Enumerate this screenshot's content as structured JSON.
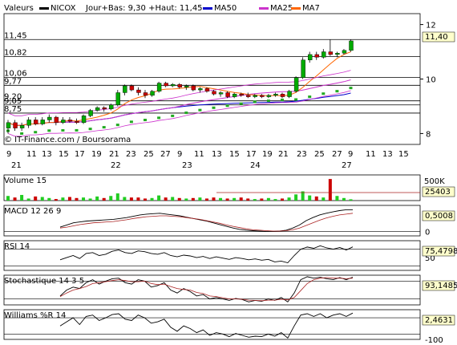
{
  "colors": {
    "price_up": "#00aa00",
    "price_down": "#cc0000",
    "ma50": "#0000cc",
    "ma25": "#cc33cc",
    "ma7": "#ff6600",
    "ma_dots_main": "#22aa22",
    "ma_dots_resist": "#aa2222",
    "grid": "#000000",
    "value_box": "#ffffcc",
    "volume_up": "#22cc22",
    "volume_down": "#cc0000",
    "indicator_line": "#000000",
    "signal_line": "#aa2222"
  },
  "legend": {
    "title": "Valeurs",
    "symbol": "NICOX",
    "day_range": "Jour+Bas: 9,30 +Haut: 11,45",
    "ma50": "MA50",
    "ma25": "MA25",
    "ma7": "MA7"
  },
  "watermark": "© IT-Finance.com / Boursorama",
  "chart_data": [
    {
      "type": "candlestick",
      "title": "NICOX",
      "ylim": [
        7.6,
        12.4
      ],
      "y_ticks": [
        "12",
        "10",
        "8"
      ],
      "price_levels": [
        {
          "label": "11,45",
          "value": 11.45
        },
        {
          "label": "10,82",
          "value": 10.82
        },
        {
          "label": "10,06",
          "value": 10.06
        },
        {
          "label": "9,77",
          "value": 9.77
        },
        {
          "label": "9,20",
          "value": 9.2
        },
        {
          "label": "9,05",
          "value": 9.05
        },
        {
          "label": "8,75",
          "value": 8.75
        }
      ],
      "last_value": "11,40",
      "x_tick_labels": [
        "9",
        "11",
        "13",
        "15",
        "17",
        "19",
        "21",
        "23",
        "25",
        "27"
      ],
      "month_labels": [
        "21",
        "22",
        "23",
        "24",
        "27"
      ],
      "candles": [
        {
          "o": 8.2,
          "h": 8.5,
          "l": 8.0,
          "c": 8.4
        },
        {
          "o": 8.4,
          "h": 8.5,
          "l": 8.1,
          "c": 8.2
        },
        {
          "o": 8.2,
          "h": 8.4,
          "l": 8.1,
          "c": 8.3
        },
        {
          "o": 8.3,
          "h": 8.6,
          "l": 8.2,
          "c": 8.5
        },
        {
          "o": 8.5,
          "h": 8.6,
          "l": 8.3,
          "c": 8.35
        },
        {
          "o": 8.35,
          "h": 8.6,
          "l": 8.3,
          "c": 8.5
        },
        {
          "o": 8.5,
          "h": 8.7,
          "l": 8.4,
          "c": 8.6
        },
        {
          "o": 8.6,
          "h": 8.65,
          "l": 8.3,
          "c": 8.4
        },
        {
          "o": 8.4,
          "h": 8.6,
          "l": 8.35,
          "c": 8.5
        },
        {
          "o": 8.5,
          "h": 8.6,
          "l": 8.4,
          "c": 8.45
        },
        {
          "o": 8.45,
          "h": 8.55,
          "l": 8.35,
          "c": 8.4
        },
        {
          "o": 8.4,
          "h": 8.7,
          "l": 8.35,
          "c": 8.65
        },
        {
          "o": 8.65,
          "h": 8.9,
          "l": 8.6,
          "c": 8.85
        },
        {
          "o": 8.85,
          "h": 9.0,
          "l": 8.8,
          "c": 8.95
        },
        {
          "o": 8.95,
          "h": 9.0,
          "l": 8.8,
          "c": 8.9
        },
        {
          "o": 8.9,
          "h": 9.1,
          "l": 8.85,
          "c": 9.05
        },
        {
          "o": 9.05,
          "h": 9.6,
          "l": 9.0,
          "c": 9.5
        },
        {
          "o": 9.5,
          "h": 9.8,
          "l": 9.4,
          "c": 9.75
        },
        {
          "o": 9.75,
          "h": 9.8,
          "l": 9.55,
          "c": 9.6
        },
        {
          "o": 9.6,
          "h": 9.7,
          "l": 9.4,
          "c": 9.5
        },
        {
          "o": 9.5,
          "h": 9.6,
          "l": 9.3,
          "c": 9.4
        },
        {
          "o": 9.4,
          "h": 9.6,
          "l": 9.35,
          "c": 9.55
        },
        {
          "o": 9.55,
          "h": 9.9,
          "l": 9.5,
          "c": 9.85
        },
        {
          "o": 9.85,
          "h": 9.9,
          "l": 9.7,
          "c": 9.75
        },
        {
          "o": 9.75,
          "h": 9.85,
          "l": 9.7,
          "c": 9.8
        },
        {
          "o": 9.8,
          "h": 9.85,
          "l": 9.65,
          "c": 9.7
        },
        {
          "o": 9.7,
          "h": 9.8,
          "l": 9.6,
          "c": 9.75
        },
        {
          "o": 9.75,
          "h": 9.8,
          "l": 9.55,
          "c": 9.6
        },
        {
          "o": 9.6,
          "h": 9.7,
          "l": 9.5,
          "c": 9.65
        },
        {
          "o": 9.65,
          "h": 9.7,
          "l": 9.5,
          "c": 9.55
        },
        {
          "o": 9.55,
          "h": 9.6,
          "l": 9.4,
          "c": 9.45
        },
        {
          "o": 9.45,
          "h": 9.55,
          "l": 9.35,
          "c": 9.5
        },
        {
          "o": 9.5,
          "h": 9.55,
          "l": 9.3,
          "c": 9.35
        },
        {
          "o": 9.35,
          "h": 9.5,
          "l": 9.3,
          "c": 9.45
        },
        {
          "o": 9.45,
          "h": 9.5,
          "l": 9.35,
          "c": 9.4
        },
        {
          "o": 9.4,
          "h": 9.5,
          "l": 9.3,
          "c": 9.35
        },
        {
          "o": 9.35,
          "h": 9.45,
          "l": 9.3,
          "c": 9.4
        },
        {
          "o": 9.4,
          "h": 9.45,
          "l": 9.3,
          "c": 9.35
        },
        {
          "o": 9.35,
          "h": 9.45,
          "l": 9.3,
          "c": 9.4
        },
        {
          "o": 9.4,
          "h": 9.5,
          "l": 9.35,
          "c": 9.45
        },
        {
          "o": 9.45,
          "h": 9.5,
          "l": 9.3,
          "c": 9.35
        },
        {
          "o": 9.35,
          "h": 9.6,
          "l": 9.3,
          "c": 9.55
        },
        {
          "o": 9.55,
          "h": 10.1,
          "l": 9.5,
          "c": 10.05
        },
        {
          "o": 10.05,
          "h": 10.8,
          "l": 10.0,
          "c": 10.7
        },
        {
          "o": 10.7,
          "h": 11.0,
          "l": 10.6,
          "c": 10.9
        },
        {
          "o": 10.9,
          "h": 11.0,
          "l": 10.7,
          "c": 10.8
        },
        {
          "o": 10.8,
          "h": 11.1,
          "l": 10.75,
          "c": 11.0
        },
        {
          "o": 11.0,
          "h": 11.45,
          "l": 10.85,
          "c": 10.9
        },
        {
          "o": 10.9,
          "h": 11.0,
          "l": 10.8,
          "c": 10.95
        },
        {
          "o": 10.95,
          "h": 11.1,
          "l": 10.9,
          "c": 11.05
        },
        {
          "o": 11.05,
          "h": 11.45,
          "l": 11.0,
          "c": 11.4
        }
      ]
    },
    {
      "type": "bar",
      "title": "Volume 15",
      "y_ticks": [
        "500K"
      ],
      "last_value": "25403",
      "ylim": [
        0,
        500000
      ],
      "values": [
        90000,
        60000,
        110000,
        40000,
        80000,
        70000,
        50000,
        30000,
        60000,
        70000,
        50000,
        60000,
        40000,
        80000,
        50000,
        90000,
        140000,
        70000,
        60000,
        60000,
        40000,
        50000,
        100000,
        60000,
        70000,
        50000,
        40000,
        50000,
        60000,
        40000,
        60000,
        50000,
        40000,
        50000,
        60000,
        40000,
        30000,
        40000,
        50000,
        30000,
        40000,
        60000,
        120000,
        180000,
        100000,
        80000,
        60000,
        420000,
        90000,
        50000,
        25403
      ]
    },
    {
      "type": "line",
      "title": "MACD 12 26 9",
      "y_ticks": [
        "0"
      ],
      "last_value": "0,5008",
      "ylim": [
        -0.1,
        0.6
      ],
      "series": [
        {
          "values": [
            0.1,
            0.15,
            0.2,
            0.22,
            0.24,
            0.25,
            0.26,
            0.27,
            0.28,
            0.3,
            0.32,
            0.35,
            0.38,
            0.4,
            0.41,
            0.42,
            0.4,
            0.38,
            0.36,
            0.33,
            0.3,
            0.27,
            0.24,
            0.2,
            0.16,
            0.12,
            0.08,
            0.05,
            0.03,
            0.02,
            0.01,
            0.0,
            0.0,
            0.01,
            0.03,
            0.08,
            0.15,
            0.25,
            0.32,
            0.38,
            0.42,
            0.45,
            0.48,
            0.5,
            0.5008
          ]
        },
        {
          "values": [
            0.08,
            0.1,
            0.13,
            0.16,
            0.18,
            0.2,
            0.21,
            0.22,
            0.23,
            0.25,
            0.27,
            0.3,
            0.32,
            0.34,
            0.35,
            0.36,
            0.36,
            0.35,
            0.34,
            0.32,
            0.3,
            0.28,
            0.25,
            0.22,
            0.19,
            0.15,
            0.12,
            0.09,
            0.06,
            0.04,
            0.03,
            0.02,
            0.01,
            0.01,
            0.02,
            0.04,
            0.08,
            0.14,
            0.2,
            0.26,
            0.31,
            0.35,
            0.38,
            0.4,
            0.42
          ]
        }
      ]
    },
    {
      "type": "line",
      "title": "RSI 14",
      "y_ticks": [
        "50"
      ],
      "last_value": "75,4798",
      "ylim": [
        20,
        90
      ],
      "series": [
        {
          "values": [
            45,
            50,
            55,
            48,
            60,
            62,
            55,
            58,
            65,
            68,
            62,
            60,
            66,
            64,
            60,
            58,
            62,
            55,
            52,
            56,
            54,
            50,
            53,
            48,
            52,
            49,
            46,
            50,
            48,
            45,
            47,
            44,
            46,
            40,
            42,
            38,
            55,
            70,
            75,
            72,
            78,
            73,
            70,
            74,
            68,
            75.48
          ]
        }
      ]
    },
    {
      "type": "line",
      "title": "Stochastique 14 3 5",
      "last_value": "93,1485",
      "ylim": [
        0,
        100
      ],
      "series": [
        {
          "values": [
            30,
            50,
            60,
            55,
            75,
            85,
            70,
            80,
            88,
            90,
            75,
            70,
            85,
            80,
            60,
            65,
            75,
            50,
            40,
            55,
            45,
            30,
            35,
            20,
            25,
            20,
            15,
            22,
            18,
            10,
            15,
            12,
            20,
            15,
            25,
            10,
            40,
            85,
            95,
            90,
            93,
            88,
            85,
            92,
            85,
            93.1485
          ]
        },
        {
          "values": [
            28,
            40,
            50,
            55,
            62,
            72,
            75,
            78,
            82,
            85,
            82,
            78,
            78,
            80,
            72,
            68,
            70,
            62,
            55,
            52,
            50,
            42,
            38,
            30,
            28,
            24,
            20,
            20,
            19,
            16,
            15,
            14,
            16,
            16,
            19,
            17,
            25,
            48,
            72,
            85,
            90,
            92,
            90,
            90,
            88,
            90
          ]
        }
      ]
    },
    {
      "type": "line",
      "title": "Williams %R 14",
      "y_ticks": [
        "-100"
      ],
      "last_value": "2,4631",
      "ylim": [
        -100,
        10
      ],
      "series": [
        {
          "values": [
            -50,
            -35,
            -20,
            -45,
            -15,
            -10,
            -30,
            -20,
            -8,
            -5,
            -25,
            -30,
            -10,
            -20,
            -40,
            -35,
            -25,
            -55,
            -70,
            -50,
            -60,
            -75,
            -65,
            -85,
            -75,
            -80,
            -90,
            -78,
            -85,
            -92,
            -88,
            -90,
            -80,
            -88,
            -75,
            -95,
            -50,
            -10,
            -5,
            -15,
            -5,
            -20,
            -10,
            -5,
            -15,
            -2.4631
          ]
        }
      ]
    }
  ]
}
